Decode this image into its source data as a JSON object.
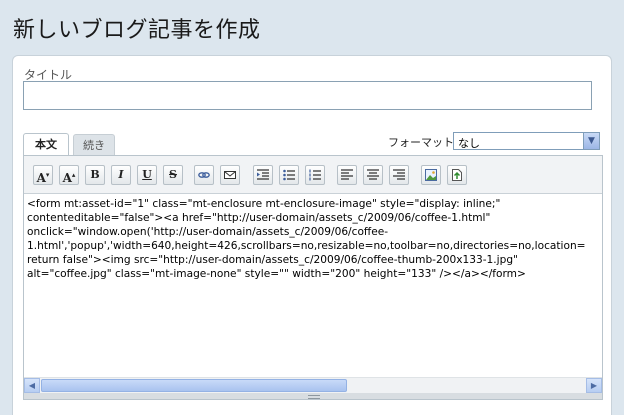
{
  "page": {
    "title": "新しいブログ記事を作成"
  },
  "title_field": {
    "label": "タイトル",
    "value": ""
  },
  "tabs": [
    {
      "label": "本文",
      "active": true
    },
    {
      "label": "続き",
      "active": false
    }
  ],
  "format": {
    "label": "フォーマット:",
    "selected": "なし"
  },
  "toolbar": {
    "buttons": [
      {
        "name": "font-size-smaller-button",
        "glyph": "A",
        "icon": "font-size-smaller-icon"
      },
      {
        "name": "font-size-larger-button",
        "glyph": "A",
        "icon": "font-size-larger-icon"
      },
      {
        "name": "bold-button",
        "glyph": "B",
        "icon": "bold-icon"
      },
      {
        "name": "italic-button",
        "glyph": "I",
        "icon": "italic-icon"
      },
      {
        "name": "underline-button",
        "glyph": "U",
        "icon": "underline-icon"
      },
      {
        "name": "strikethrough-button",
        "glyph": "S",
        "icon": "strikethrough-icon"
      },
      {
        "name": "insert-link-button",
        "icon": "link-icon"
      },
      {
        "name": "insert-email-button",
        "icon": "email-icon"
      },
      {
        "name": "indent-button",
        "icon": "indent-icon"
      },
      {
        "name": "bulleted-list-button",
        "icon": "bulleted-list-icon"
      },
      {
        "name": "numbered-list-button",
        "icon": "numbered-list-icon"
      },
      {
        "name": "align-left-button",
        "icon": "align-left-icon"
      },
      {
        "name": "align-center-button",
        "icon": "align-center-icon"
      },
      {
        "name": "align-right-button",
        "icon": "align-right-icon"
      },
      {
        "name": "insert-image-button",
        "icon": "image-icon"
      },
      {
        "name": "insert-file-button",
        "icon": "file-upload-icon"
      }
    ]
  },
  "editor": {
    "lines": [
      "<form mt:asset-id=\"1\" class=\"mt-enclosure mt-enclosure-image\" style=\"display: inline;\"",
      "contenteditable=\"false\"><a href=\"http://user-domain/assets_c/2009/06/coffee-1.html\"",
      "onclick=\"window.open('http://user-domain/assets_c/2009/06/coffee-",
      "1.html','popup','width=640,height=426,scrollbars=no,resizable=no,toolbar=no,directories=no,location=",
      "return false\"><img src=\"http://user-domain/assets_c/2009/06/coffee-thumb-200x133-1.jpg\"",
      "alt=\"coffee.jpg\" class=\"mt-image-none\" style=\"\" width=\"200\" height=\"133\" /></a></form>"
    ]
  },
  "colors": {
    "background": "#dce6ee",
    "accent": "#7f9db9",
    "scroll": "#b6cdf2"
  }
}
